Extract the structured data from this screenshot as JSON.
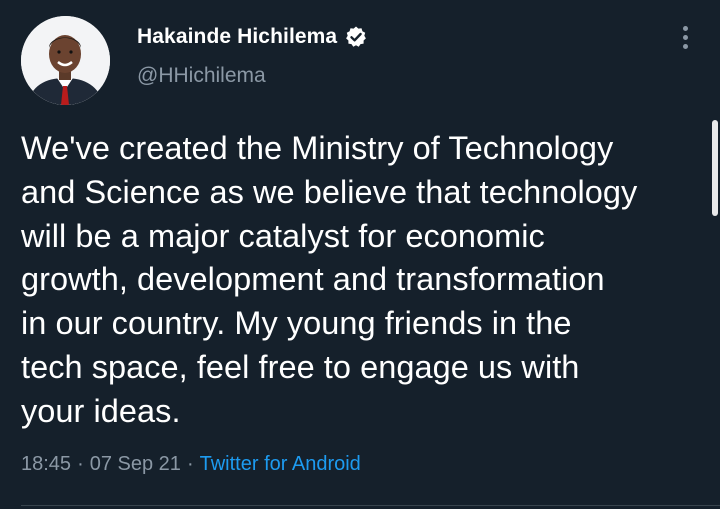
{
  "user": {
    "display_name": "Hakainde Hichilema",
    "handle": "@HHichilema",
    "verified": true
  },
  "tweet": {
    "text": "We've created the Ministry of Technology and Science as we believe that technology will be a major catalyst for economic growth, development and transformation in our country. My young friends in the tech space, feel free to engage us with your ideas.",
    "lines": [
      "We've created the Ministry of Technology",
      "and Science as we believe that technology",
      "will be a major catalyst for economic",
      "growth, development and transformation",
      "in our country. My young friends in the",
      "tech space, feel free to engage us with",
      "your ideas."
    ],
    "time": "18:45",
    "date": "07 Sep 21",
    "separator": "·",
    "source": "Twitter for Android"
  },
  "icons": {
    "verified": "verified-badge-icon",
    "more": "more-options-icon"
  },
  "colors": {
    "background": "#15202b",
    "text": "#ffffff",
    "secondary": "#8b98a5",
    "link": "#1d9bf0",
    "divider": "#38444d"
  }
}
